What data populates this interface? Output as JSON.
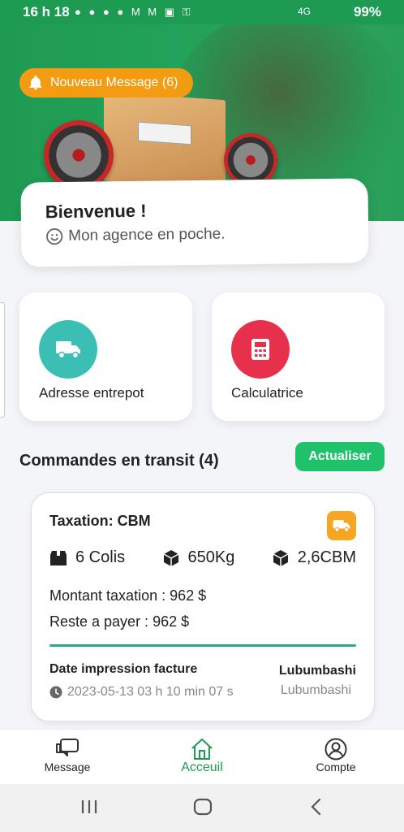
{
  "statusbar": {
    "time": "16 h 18",
    "battery": "99%",
    "network": "4G"
  },
  "notification": {
    "label": "Nouveau Message (6)",
    "icon": "bell-icon"
  },
  "welcome": {
    "title": "Bienvenue !",
    "subtitle": "Mon agence en poche."
  },
  "quick_actions": [
    {
      "label": "Adresse entrepot",
      "icon": "truck-icon",
      "color": "#3bbfb4"
    },
    {
      "label": "Calculatrice",
      "icon": "calculator-icon",
      "color": "#e6304c"
    }
  ],
  "transit": {
    "title": "Commandes en transit (4)",
    "refresh_label": "Actualiser"
  },
  "order": {
    "taxation": "Taxation: CBM",
    "colis": "6 Colis",
    "weight": "650Kg",
    "volume": "2,6CBM",
    "montant_label": "Montant taxation :",
    "montant_value": "962 $",
    "reste_label": "Reste a payer :",
    "reste_value": "962 $",
    "date_label": "Date impression facture",
    "date_value": "2023-05-13 03 h 10 min 07 s",
    "city_from": "Lubumbashi",
    "city_to": "Lubumbashi"
  },
  "bottom_nav": {
    "message": "Message",
    "home": "Acceuil",
    "account": "Compte"
  },
  "colors": {
    "brand_green": "#1e9b53",
    "accent_orange": "#f39c12",
    "refresh_green": "#1fc16b"
  }
}
